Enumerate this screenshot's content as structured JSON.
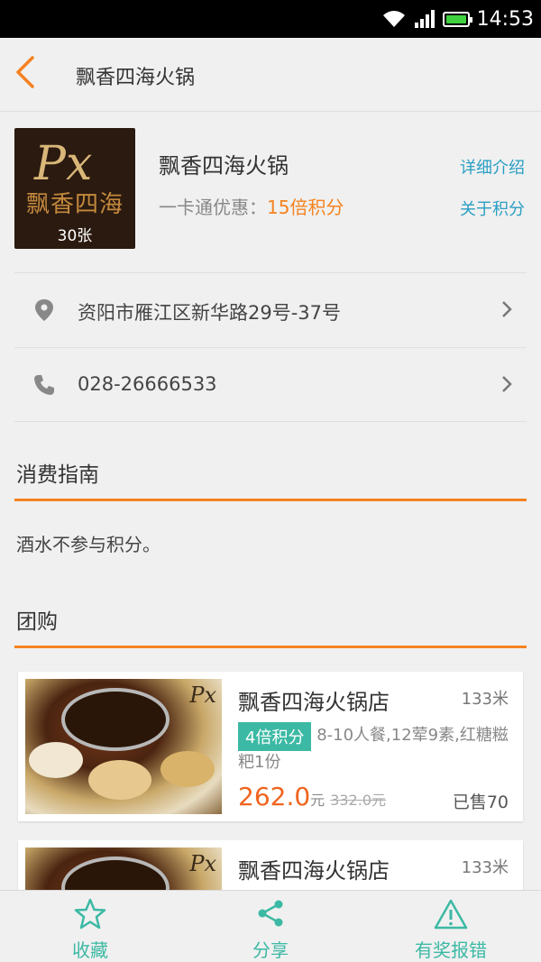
{
  "status_bar": {
    "time": "14:53"
  },
  "header": {
    "title": "飘香四海火锅"
  },
  "store": {
    "name": "飘香四海火锅",
    "promo_label": "一卡通优惠：",
    "promo_value": "15倍积分",
    "link_detail": "详细介绍",
    "link_points": "关于积分",
    "logo_text": "飘香四海",
    "logo_monogram": "Px",
    "photo_count": "30张",
    "address": "资阳市雁江区新华路29号-37号",
    "phone": "028-26666533"
  },
  "guide": {
    "title": "消费指南",
    "text": "酒水不参与积分。"
  },
  "group_buy": {
    "title": "团购",
    "deals": [
      {
        "name": "飘香四海火锅店",
        "distance": "133米",
        "tag": "4倍积分",
        "desc": "8-10人餐,12荤9素,红糖糍粑1份",
        "price": "262.0",
        "yuan": "元",
        "orig_price": "332.0元",
        "sold": "已售70"
      },
      {
        "name": "飘香四海火锅店",
        "distance": "133米",
        "tag": "",
        "desc": "",
        "price": "",
        "yuan": "",
        "orig_price": "",
        "sold": ""
      }
    ]
  },
  "bottom_bar": {
    "favorite": "收藏",
    "share": "分享",
    "report": "有奖报错"
  },
  "colors": {
    "accent": "#f5821f",
    "teal": "#3cb9a4",
    "link": "#2a9fc4",
    "price": "#f0641e"
  },
  "icons": [
    "back-arrow-icon",
    "location-pin-icon",
    "phone-icon",
    "chevron-right-icon",
    "star-icon",
    "share-icon",
    "warning-icon",
    "wifi-icon",
    "signal-icon",
    "battery-icon"
  ]
}
